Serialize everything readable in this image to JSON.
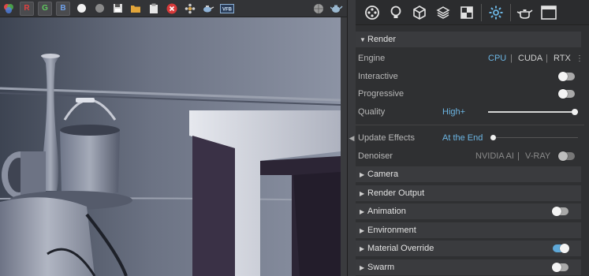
{
  "viewport_toolbar": {
    "channels": [
      "R",
      "G",
      "B"
    ],
    "icons": [
      "white-ball-icon",
      "grey-ball-icon",
      "save-icon",
      "folder-icon",
      "clipboard-icon",
      "stop-icon",
      "node-icon",
      "teapot-eye-icon",
      "frame-buffer-icon",
      "sphere-icon",
      "teapot-icon"
    ]
  },
  "panel_toolbar": {
    "icons": [
      "render-settings-icon",
      "light-icon",
      "geometry-icon",
      "layers-icon",
      "render-elements-icon",
      "settings-icon",
      "teapot-icon",
      "frame-buffer-window-icon"
    ]
  },
  "render": {
    "header": "Render",
    "engine_label": "Engine",
    "engine_options": [
      "CPU",
      "CUDA",
      "RTX"
    ],
    "engine_selected": "CPU",
    "interactive_label": "Interactive",
    "interactive_on": false,
    "progressive_label": "Progressive",
    "progressive_on": false,
    "quality_label": "Quality",
    "quality_value": "High+",
    "quality_level": 1.0,
    "update_effects_label": "Update Effects",
    "update_effects_value": "At the End",
    "update_effects_level": 0.0,
    "denoiser_label": "Denoiser",
    "denoiser_options": [
      "NVIDIA AI",
      "V-RAY"
    ],
    "denoiser_on": false
  },
  "sections": [
    {
      "label": "Camera",
      "toggle": null
    },
    {
      "label": "Render Output",
      "toggle": null
    },
    {
      "label": "Animation",
      "toggle": false
    },
    {
      "label": "Environment",
      "toggle": null
    },
    {
      "label": "Material Override",
      "toggle": true
    },
    {
      "label": "Swarm",
      "toggle": false
    }
  ],
  "colors": {
    "accent": "#6cb6e4",
    "panel_bg": "#2f3032",
    "header_bg": "#3a3b3e"
  }
}
